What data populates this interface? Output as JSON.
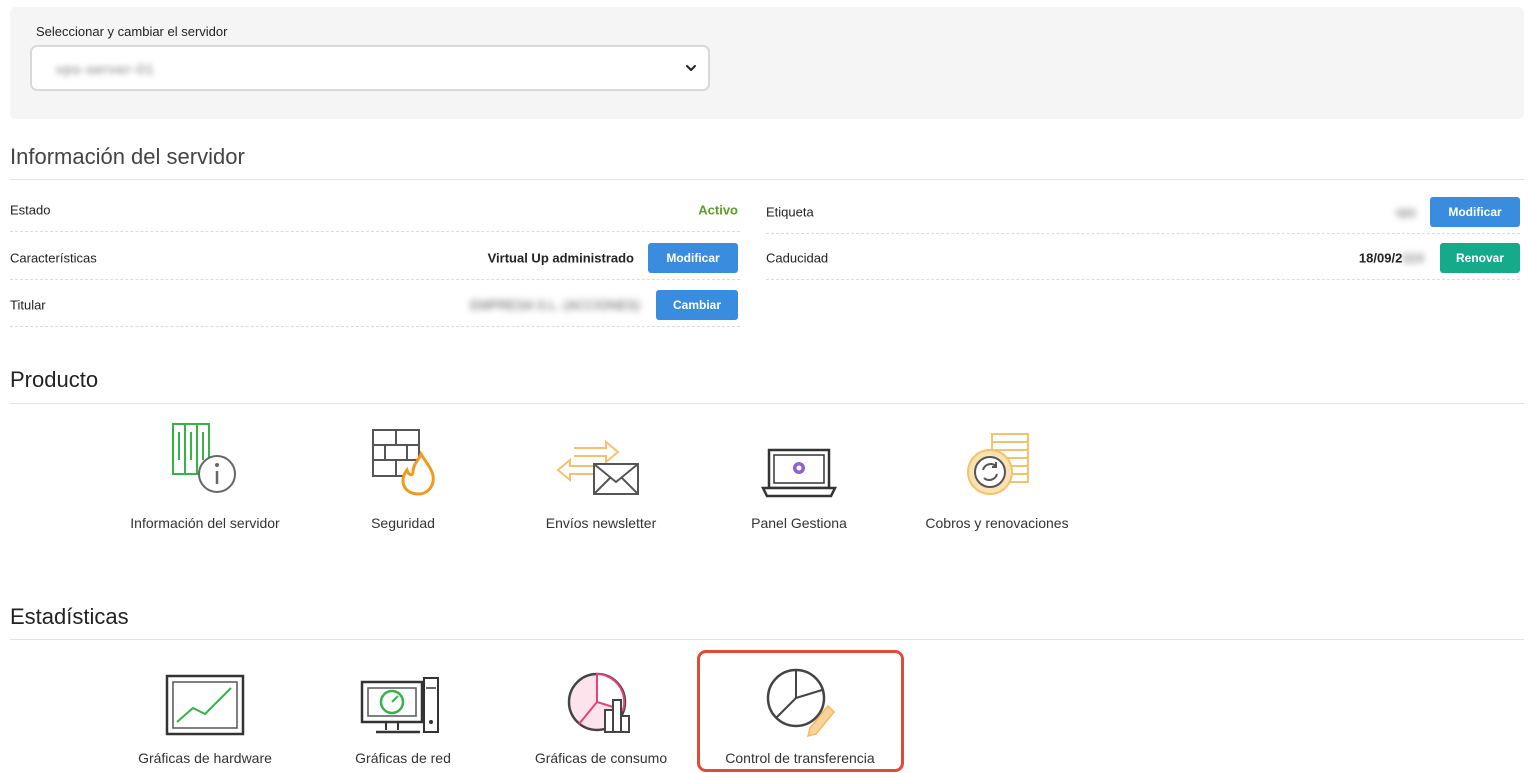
{
  "selector": {
    "label": "Seleccionar y cambiar el servidor",
    "value": "vps-server-01"
  },
  "server_info": {
    "title": "Información del servidor",
    "left_rows": [
      {
        "label": "Estado",
        "value": "Activo"
      },
      {
        "label": "Características",
        "value": "Virtual Up administrado",
        "button": "Modificar"
      },
      {
        "label": "Titular",
        "value": "EMPRESA S.L. (ACCIONES)",
        "button": "Cambiar"
      }
    ],
    "right_rows": [
      {
        "label": "Etiqueta",
        "value": "vps",
        "button": "Modificar"
      },
      {
        "label": "Caducidad",
        "value": "18/09/2",
        "value_blur": "024",
        "button": "Renovar"
      }
    ]
  },
  "product": {
    "title": "Producto",
    "items": [
      {
        "label": "Información del servidor",
        "icon": "server-info-icon"
      },
      {
        "label": "Seguridad",
        "icon": "firewall-icon"
      },
      {
        "label": "Envíos newsletter",
        "icon": "newsletter-icon"
      },
      {
        "label": "Panel Gestiona",
        "icon": "laptop-panel-icon"
      },
      {
        "label": "Cobros y renovaciones",
        "icon": "billing-icon"
      }
    ]
  },
  "statistics": {
    "title": "Estadísticas",
    "items": [
      {
        "label": "Gráficas de hardware",
        "icon": "hardware-chart-icon"
      },
      {
        "label": "Gráficas de red",
        "icon": "network-chart-icon"
      },
      {
        "label": "Gráficas de consumo",
        "icon": "consumption-chart-icon"
      },
      {
        "label": "Control de transferencia",
        "icon": "transfer-control-icon"
      }
    ]
  },
  "colors": {
    "status_active": "#5a9e23",
    "button_blue": "#3a8dde",
    "button_teal": "#15ab8a",
    "highlight": "#e04a37"
  }
}
